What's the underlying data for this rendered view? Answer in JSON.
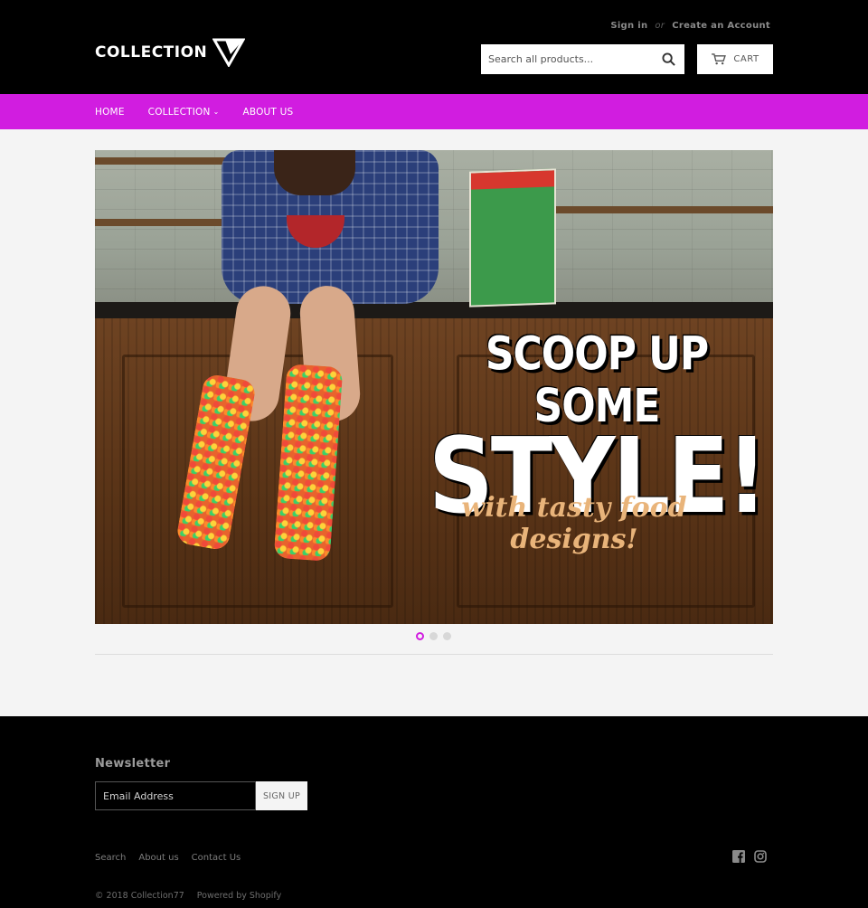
{
  "header": {
    "logo_text": "COLLECTION",
    "account": {
      "sign_in": "Sign in",
      "or": "or",
      "create_account": "Create an Account"
    },
    "search": {
      "placeholder": "Search all products..."
    },
    "cart_label": "CART"
  },
  "nav": {
    "items": [
      {
        "label": "HOME"
      },
      {
        "label": "COLLECTION",
        "has_dropdown": true
      },
      {
        "label": "ABOUT US"
      }
    ],
    "background": "#d11de0"
  },
  "hero": {
    "headline_line1": "SCOOP UP SOME",
    "headline_line2": "STYLE!",
    "tagline": "with tasty food designs!",
    "slides_total": 3,
    "active_slide": 1
  },
  "footer": {
    "newsletter_title": "Newsletter",
    "email_placeholder": "Email Address",
    "signup_label": "SIGN UP",
    "links": [
      {
        "label": "Search"
      },
      {
        "label": "About us"
      },
      {
        "label": "Contact Us"
      }
    ],
    "social": [
      "facebook-icon",
      "instagram-icon"
    ],
    "copyright": "© 2018 Collection77",
    "powered_by": "Powered by Shopify"
  },
  "colors": {
    "accent": "#d11de0",
    "header_bg": "#000000",
    "page_bg": "#f4f4f4"
  }
}
